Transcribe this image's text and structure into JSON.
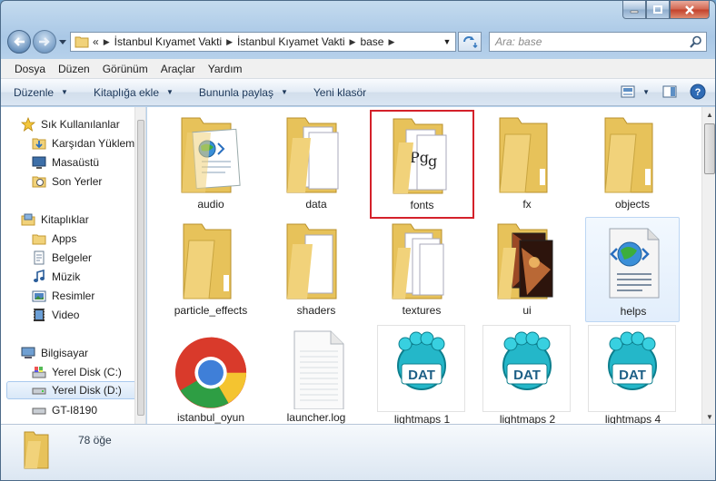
{
  "window": {
    "caption_buttons": [
      "minimize-icon",
      "maximize-icon",
      "close-icon"
    ]
  },
  "address_bar": {
    "overflow": "«",
    "crumbs": [
      "İstanbul Kıyamet Vakti",
      "İstanbul Kıyamet Vakti",
      "base"
    ],
    "search_placeholder": "Ara: base"
  },
  "menu": [
    "Dosya",
    "Düzen",
    "Görünüm",
    "Araçlar",
    "Yardım"
  ],
  "commands": {
    "organize": "Düzenle",
    "library": "Kitaplığa ekle",
    "share": "Bununla paylaş",
    "new_folder": "Yeni klasör"
  },
  "nav": {
    "favorites_header": "Sık Kullanılanlar",
    "favorites": [
      "Karşıdan Yüklem",
      "Masaüstü",
      "Son Yerler"
    ],
    "libraries_header": "Kitaplıklar",
    "libraries": [
      "Apps",
      "Belgeler",
      "Müzik",
      "Resimler",
      "Video"
    ],
    "computer_header": "Bilgisayar",
    "drives": [
      "Yerel Disk (C:)",
      "Yerel Disk (D:)",
      "GT-I8190"
    ]
  },
  "files": [
    {
      "name": "audio",
      "icon": "folder-media-icon"
    },
    {
      "name": "data",
      "icon": "folder-docs-icon"
    },
    {
      "name": "fonts",
      "icon": "folder-fonts-icon"
    },
    {
      "name": "fx",
      "icon": "folder-icon"
    },
    {
      "name": "objects",
      "icon": "folder-icon"
    },
    {
      "name": "particle_effects",
      "icon": "folder-icon"
    },
    {
      "name": "shaders",
      "icon": "folder-docs-icon"
    },
    {
      "name": "textures",
      "icon": "folder-docs-icon"
    },
    {
      "name": "ui",
      "icon": "folder-images-icon"
    },
    {
      "name": "helps",
      "icon": "html-file-icon"
    },
    {
      "name": "istanbul_oyun",
      "icon": "chrome-icon"
    },
    {
      "name": "launcher.log",
      "icon": "text-file-icon"
    },
    {
      "name": "lightmaps 1",
      "icon": "dat-file-icon"
    },
    {
      "name": "lightmaps 2",
      "icon": "dat-file-icon"
    },
    {
      "name": "lightmaps 4",
      "icon": "dat-file-icon"
    }
  ],
  "status": {
    "item_count": "78 öğe"
  }
}
